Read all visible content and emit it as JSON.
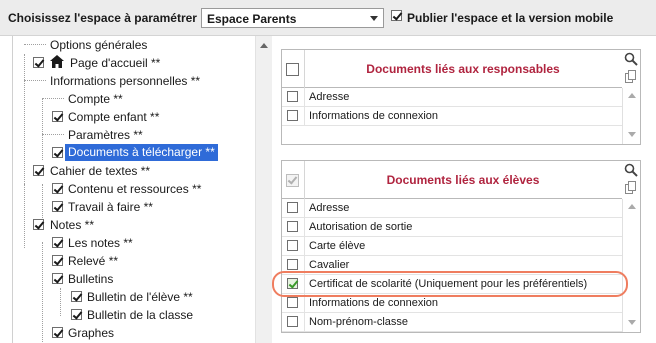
{
  "topbar": {
    "label": "Choisissez l'espace à paramétrer",
    "select_value": "Espace Parents",
    "publish_label": "Publier l'espace et la version mobile",
    "publish_checked": true
  },
  "tree": {
    "items": [
      {
        "label": "Options générales",
        "checked": null
      },
      {
        "label": "Page d'accueil **",
        "checked": true,
        "icon": "home-icon"
      },
      {
        "label": "Informations personnelles **",
        "checked": null
      },
      {
        "label": "Compte **",
        "checked": null
      },
      {
        "label": "Compte enfant **",
        "checked": true
      },
      {
        "label": "Paramètres **",
        "checked": null
      },
      {
        "label": "Documents à télécharger **",
        "checked": true,
        "selected": true
      },
      {
        "label": "Cahier de textes **",
        "checked": true
      },
      {
        "label": "Contenu et ressources **",
        "checked": true
      },
      {
        "label": "Travail à faire **",
        "checked": true
      },
      {
        "label": "Notes **",
        "checked": true
      },
      {
        "label": "Les notes **",
        "checked": true
      },
      {
        "label": "Relevé **",
        "checked": true
      },
      {
        "label": "Bulletins",
        "checked": true
      },
      {
        "label": "Bulletin de l'élève **",
        "checked": true
      },
      {
        "label": "Bulletin de la classe",
        "checked": true
      },
      {
        "label": "Graphes",
        "checked": true
      }
    ]
  },
  "panel_responsables": {
    "title": "Documents liés aux responsables",
    "rows": [
      {
        "label": "Adresse",
        "checked": false
      },
      {
        "label": "Informations de connexion",
        "checked": false
      }
    ]
  },
  "panel_eleves": {
    "title": "Documents liés aux élèves",
    "rows": [
      {
        "label": "Adresse",
        "checked": false
      },
      {
        "label": "Autorisation de sortie",
        "checked": false
      },
      {
        "label": "Carte élève",
        "checked": false
      },
      {
        "label": "Cavalier",
        "checked": false
      },
      {
        "label": "Certificat de scolarité (Uniquement pour les préférentiels)",
        "checked": true
      },
      {
        "label": "Informations de connexion",
        "checked": false
      },
      {
        "label": "Nom-prénom-classe",
        "checked": false
      }
    ]
  },
  "colors": {
    "title_red": "#b0243f",
    "selection_blue": "#2f6bd8",
    "highlight_orange": "#ef7d5f"
  }
}
